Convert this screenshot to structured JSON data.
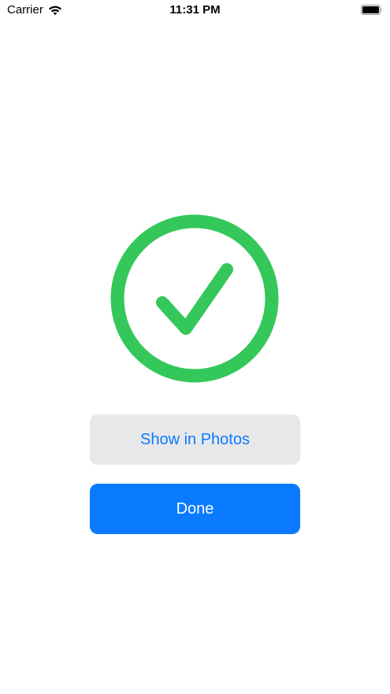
{
  "status_bar": {
    "carrier": "Carrier",
    "time": "11:31 PM",
    "wifi_icon": "wifi-icon",
    "battery_icon": "battery-icon"
  },
  "success": {
    "icon": "checkmark-circle-icon",
    "color": "#34c759"
  },
  "actions": {
    "show_in_photos_label": "Show in Photos",
    "done_label": "Done"
  },
  "colors": {
    "accent": "#0a7aff",
    "secondary_button_bg": "#e8e8ea",
    "success": "#34c759"
  }
}
